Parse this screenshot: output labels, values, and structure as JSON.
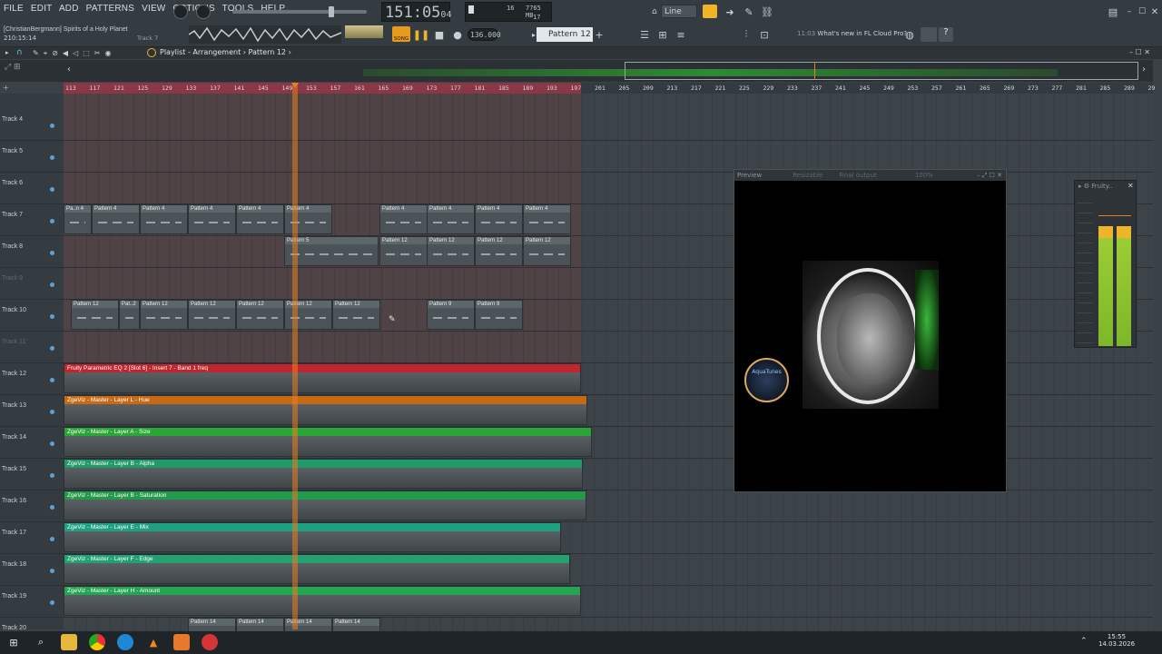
{
  "menu": [
    "FILE",
    "EDIT",
    "ADD",
    "PATTERNS",
    "VIEW",
    "OPTIONS",
    "TOOLS",
    "HELP"
  ],
  "project": {
    "author": "[ChristianBergmann]",
    "title": "Spirits of a Holy Planet",
    "time": "210:15:14",
    "track_label": "Track 7"
  },
  "transport": {
    "time": "151:05",
    "time_sub": "04",
    "tempo": "136.000",
    "mode": "SONG",
    "pattern": "Pattern 12"
  },
  "perf": {
    "cpu": "16",
    "mem": "7765 MB",
    "poly": "17"
  },
  "snap": "Line",
  "news": {
    "time": "11:03",
    "text": "What's new in FL Cloud Pro?"
  },
  "playlist": {
    "title": "Playlist - Arrangement",
    "pattern": "Pattern 12"
  },
  "ruler_ticks": [
    "113",
    "117",
    "121",
    "125",
    "129",
    "133",
    "137",
    "141",
    "145",
    "149",
    "153",
    "157",
    "161",
    "165",
    "169",
    "173",
    "177",
    "181",
    "185",
    "189",
    "193",
    "197",
    "201",
    "205",
    "209",
    "213",
    "217",
    "221",
    "225",
    "229",
    "233",
    "237",
    "241",
    "245",
    "249",
    "253",
    "257",
    "261",
    "265",
    "269",
    "273",
    "277",
    "281",
    "285",
    "289",
    "29"
  ],
  "tracks": [
    {
      "name": "Track 4",
      "dim": false
    },
    {
      "name": "Track 5",
      "dim": false
    },
    {
      "name": "Track 6",
      "dim": false
    },
    {
      "name": "Track 7",
      "dim": false
    },
    {
      "name": "Track 8",
      "dim": false
    },
    {
      "name": "Track 9",
      "dim": true
    },
    {
      "name": "Track 10",
      "dim": false
    },
    {
      "name": "Track 11",
      "dim": true
    },
    {
      "name": "Track 12",
      "dim": false
    },
    {
      "name": "Track 13",
      "dim": false
    },
    {
      "name": "Track 14",
      "dim": false
    },
    {
      "name": "Track 15",
      "dim": false
    },
    {
      "name": "Track 16",
      "dim": false
    },
    {
      "name": "Track 17",
      "dim": false
    },
    {
      "name": "Track 18",
      "dim": false
    },
    {
      "name": "Track 19",
      "dim": false
    },
    {
      "name": "Track 20",
      "dim": false
    }
  ],
  "pattern_clips": {
    "track7": [
      "Pa..n 4",
      "Pattern 4",
      "Pattern 4",
      "Pattern 4",
      "Pattern 4",
      "Pattern 4",
      "Pattern 4",
      "Pattern 4",
      "Pattern 4",
      "Pattern 4"
    ],
    "track8": [
      "Pattern 5",
      "Pattern 12",
      "Pattern 12",
      "Pattern 12",
      "Pattern 12"
    ],
    "track10": [
      "Pattern 12",
      "Pat..2",
      "Pattern 12",
      "Pattern 12",
      "Pattern 12",
      "Pattern 12",
      "Pattern 12",
      "Pattern 9",
      "Pattern 9"
    ],
    "track20": [
      "Pattern 14",
      "Pattern 14",
      "Pattern 14",
      "Pattern 14"
    ]
  },
  "automation": [
    {
      "label": "Fruity Parametric EQ 2 [Slot 6] - Insert 7 - Band 1 freq",
      "color": "#c0262d"
    },
    {
      "label": "ZgeViz - Master - Layer L - Hue",
      "color": "#c86a14"
    },
    {
      "label": "ZgeViz - Master - Layer A - Size",
      "color": "#2aa636"
    },
    {
      "label": "ZgeViz - Master - Layer B - Alpha",
      "color": "#219a6a"
    },
    {
      "label": "ZgeViz - Master - Layer B - Saturation",
      "color": "#219a4c"
    },
    {
      "label": "ZgeViz - Master - Layer E - Mix",
      "color": "#1fa081"
    },
    {
      "label": "ZgeViz - Master - Layer F - Edge",
      "color": "#22a26e"
    },
    {
      "label": "ZgeViz - Master - Layer H - Amount",
      "color": "#24a552"
    }
  ],
  "preview": {
    "title": "Preview",
    "resizable": "Resizable",
    "output": "Final output",
    "zoom": "100%"
  },
  "logo_text": "AquaTunes",
  "mixer": {
    "title": "Fruity.."
  },
  "clock": {
    "time": "15:55",
    "date": "14.03.2026"
  },
  "icons": [
    "windows-icon",
    "search-icon",
    "folder-icon",
    "chrome-icon",
    "edge-icon",
    "vlc-icon",
    "fl-studio-icon",
    "media-icon"
  ],
  "colors": {
    "accent": "#e67e22",
    "loop": "#8a3746"
  }
}
